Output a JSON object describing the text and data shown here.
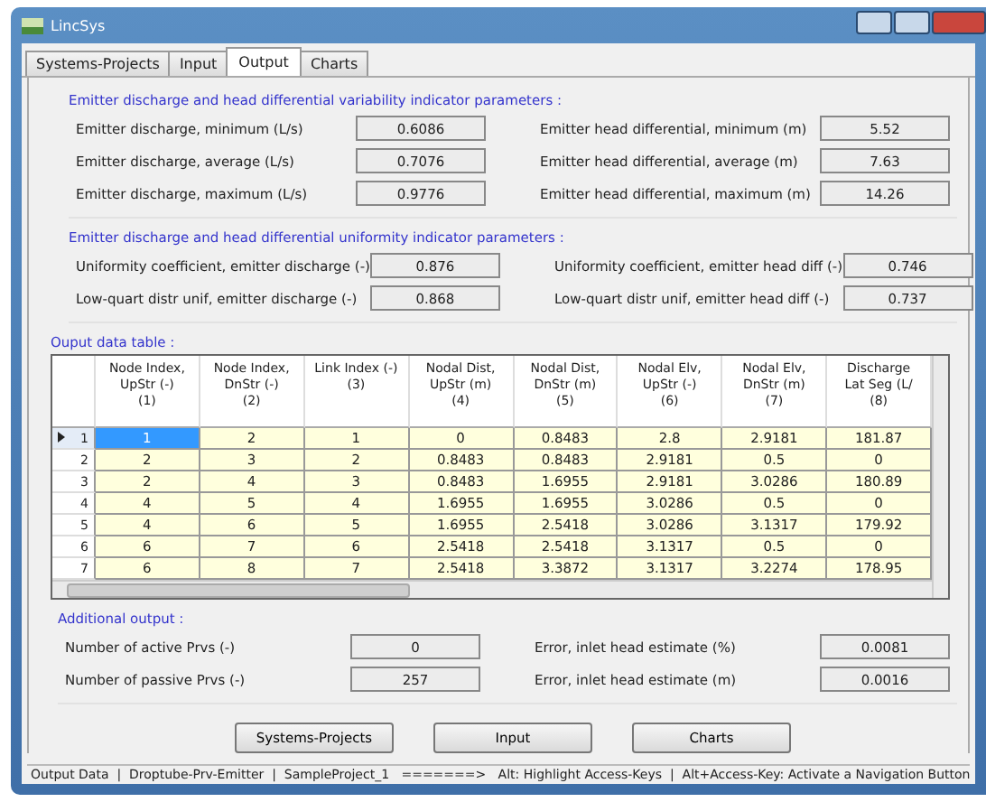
{
  "window": {
    "title": "LincSys"
  },
  "tabs": [
    {
      "label": "Systems-Projects",
      "selected": false
    },
    {
      "label": "Input",
      "selected": false
    },
    {
      "label": "Output",
      "selected": true
    },
    {
      "label": "Charts",
      "selected": false
    }
  ],
  "variability": {
    "title": "Emitter discharge and head differential variability indicator parameters :",
    "left": [
      {
        "label": "Emitter discharge, minimum  (L/s)",
        "value": "0.6086"
      },
      {
        "label": "Emitter discharge, average (L/s)",
        "value": "0.7076"
      },
      {
        "label": "Emitter discharge, maximum (L/s)",
        "value": "0.9776"
      }
    ],
    "right": [
      {
        "label": "Emitter head differential, minimum (m)",
        "value": "5.52"
      },
      {
        "label": "Emitter head differential, average  (m)",
        "value": "7.63"
      },
      {
        "label": "Emitter head differential, maximum (m)",
        "value": "14.26"
      }
    ]
  },
  "uniformity": {
    "title": "Emitter discharge and head differential uniformity indicator parameters :",
    "left": [
      {
        "label": "Uniformity coefficient, emitter discharge (-)",
        "value": "0.876"
      },
      {
        "label": "Low-quart distr unif, emitter discharge (-)",
        "value": "0.868"
      }
    ],
    "right": [
      {
        "label": "Uniformity coefficient, emitter head diff (-)",
        "value": "0.746"
      },
      {
        "label": "Low-quart distr unif, emitter head diff (-)",
        "value": "0.737"
      }
    ]
  },
  "table": {
    "title": "Ouput data table :",
    "columns": [
      {
        "heading": [
          "Node Index,",
          "UpStr (-)",
          "(1)"
        ]
      },
      {
        "heading": [
          "Node Index,",
          "DnStr (-)",
          "(2)"
        ]
      },
      {
        "heading": [
          "Link Index (-)",
          "(3)"
        ]
      },
      {
        "heading": [
          "Nodal Dist,",
          "UpStr (m)",
          "(4)"
        ]
      },
      {
        "heading": [
          "Nodal Dist,",
          "DnStr (m)",
          "(5)"
        ]
      },
      {
        "heading": [
          "Nodal Elv,",
          "UpStr (-)",
          "(6)"
        ]
      },
      {
        "heading": [
          "Nodal Elv,",
          "DnStr (m)",
          "(7)"
        ]
      },
      {
        "heading": [
          "Discharge",
          "Lat Seg (L/",
          "(8)"
        ]
      }
    ],
    "rows": [
      {
        "index": "1",
        "selected": true,
        "cells": [
          "1",
          "2",
          "1",
          "0",
          "0.8483",
          "2.8",
          "2.9181",
          "181.87"
        ]
      },
      {
        "index": "2",
        "selected": false,
        "cells": [
          "2",
          "3",
          "2",
          "0.8483",
          "0.8483",
          "2.9181",
          "0.5",
          "0"
        ]
      },
      {
        "index": "3",
        "selected": false,
        "cells": [
          "2",
          "4",
          "3",
          "0.8483",
          "1.6955",
          "2.9181",
          "3.0286",
          "180.89"
        ]
      },
      {
        "index": "4",
        "selected": false,
        "cells": [
          "4",
          "5",
          "4",
          "1.6955",
          "1.6955",
          "3.0286",
          "0.5",
          "0"
        ]
      },
      {
        "index": "5",
        "selected": false,
        "cells": [
          "4",
          "6",
          "5",
          "1.6955",
          "2.5418",
          "3.0286",
          "3.1317",
          "179.92"
        ]
      },
      {
        "index": "6",
        "selected": false,
        "cells": [
          "6",
          "7",
          "6",
          "2.5418",
          "2.5418",
          "3.1317",
          "0.5",
          "0"
        ]
      },
      {
        "index": "7",
        "selected": false,
        "cells": [
          "6",
          "8",
          "7",
          "2.5418",
          "3.3872",
          "3.1317",
          "3.2274",
          "178.95"
        ]
      }
    ]
  },
  "additional": {
    "title": "Additional output :",
    "left": [
      {
        "label": "Number of active Prvs (-)",
        "value": "0"
      },
      {
        "label": "Number of passive Prvs (-)",
        "value": "257"
      }
    ],
    "right": [
      {
        "label": "Error, inlet head estimate (%)",
        "value": "0.0081"
      },
      {
        "label": "Error, inlet head estimate (m)",
        "value": "0.0016"
      }
    ]
  },
  "buttons": [
    "Systems-Projects",
    "Input",
    "Charts"
  ],
  "status_bar": "Output Data  |  Droptube-Prv-Emitter  |  SampleProject_1   =======>   Alt: Highlight Access-Keys  |  Alt+Access-Key: Activate a Navigation Button"
}
